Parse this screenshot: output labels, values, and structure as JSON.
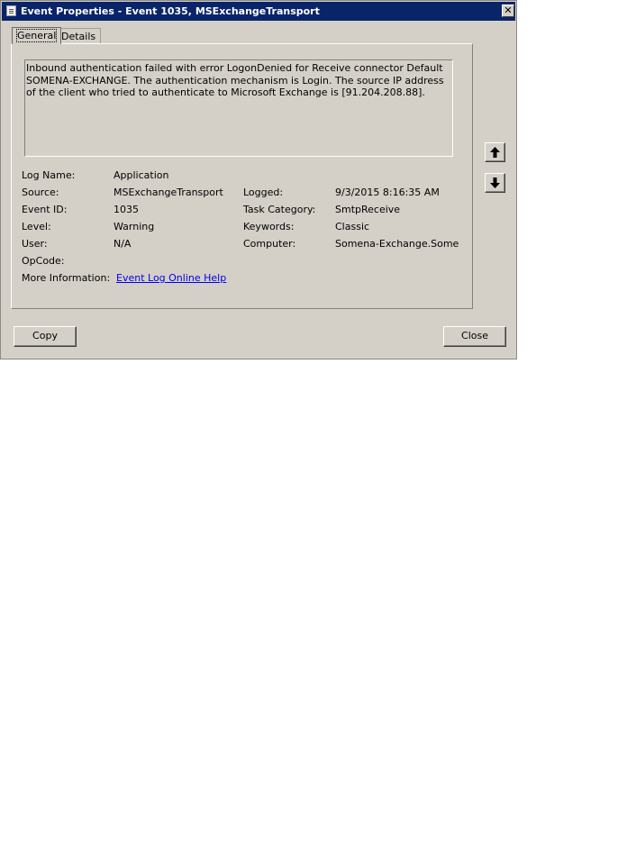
{
  "window": {
    "title": "Event Properties - Event 1035, MSExchangeTransport",
    "close_glyph": "✕"
  },
  "tabs": [
    {
      "label": "General",
      "selected": true
    },
    {
      "label": "Details",
      "selected": false
    }
  ],
  "description": "Inbound authentication failed with error LogonDenied for Receive connector Default SOMENA-EXCHANGE. The authentication mechanism is Login. The source IP address of the client who tried to authenticate to Microsoft Exchange is [91.204.208.88].",
  "fields": {
    "log_name": {
      "label": "Log Name:",
      "value": "Application"
    },
    "source": {
      "label": "Source:",
      "value": "MSExchangeTransport"
    },
    "logged": {
      "label": "Logged:",
      "value": "9/3/2015 8:16:35 AM"
    },
    "event_id": {
      "label": "Event ID:",
      "value": "1035"
    },
    "task_category": {
      "label": "Task Category:",
      "value": "SmtpReceive"
    },
    "level": {
      "label": "Level:",
      "value": "Warning"
    },
    "keywords": {
      "label": "Keywords:",
      "value": "Classic"
    },
    "user": {
      "label": "User:",
      "value": "N/A"
    },
    "computer": {
      "label": "Computer:",
      "value": "Somena-Exchange.Somena.l"
    },
    "opcode": {
      "label": "OpCode:",
      "value": ""
    },
    "more_info": {
      "label": "More Information:",
      "link": "Event Log Online Help"
    }
  },
  "buttons": {
    "copy": "Copy",
    "close": "Close"
  },
  "icons": {
    "up": "arrow-up-icon",
    "down": "arrow-down-icon"
  },
  "colors": {
    "titlebar": "#0a246a",
    "dialog_bg": "#d4d0c8",
    "link": "#0000ee"
  }
}
